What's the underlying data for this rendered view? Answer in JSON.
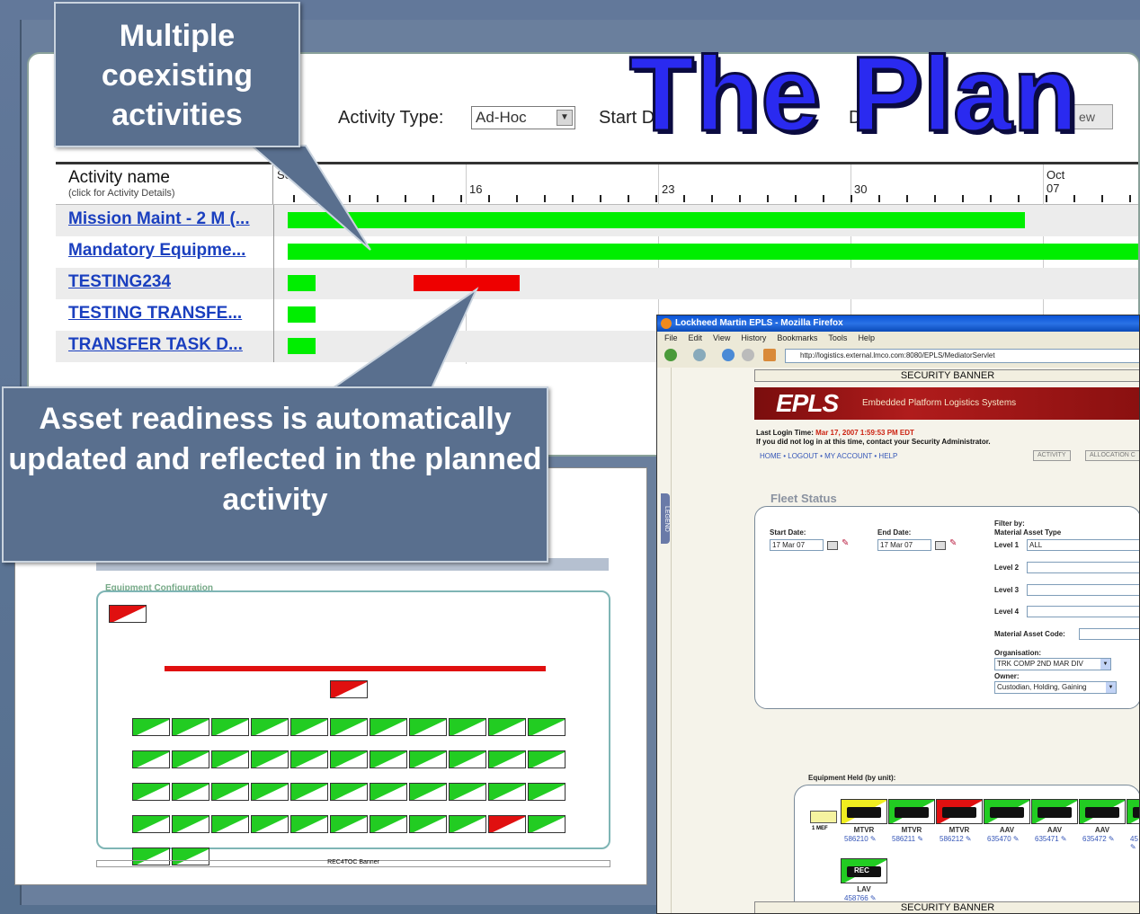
{
  "slide": {
    "title": "The Plan",
    "callout_top": "Multiple coexisting activities",
    "callout_bottom": "Asset readiness is automatically updated and reflected in the planned activity",
    "colors": {
      "background": "#5a7190",
      "callout": "#596f8e",
      "title": "#2a2af0"
    }
  },
  "gantt": {
    "toolbar": {
      "activity_type_label": "Activity Type:",
      "activity_type_value": "Ad-Hoc",
      "start_label": "Start D",
      "duration_label": "Du",
      "view_button": "ew"
    },
    "column_header": "Activity name",
    "column_subheader": "(click for Activity Details)",
    "dates": [
      {
        "label": "Sep"
      },
      {
        "label": "16"
      },
      {
        "label": "23"
      },
      {
        "label": "30"
      },
      {
        "label": "Oct\n07"
      }
    ],
    "rows": [
      {
        "name": "Mission Maint - 2 M (...",
        "bars": [
          {
            "start": 0,
            "end": 0.865,
            "color": "#00ee00"
          }
        ]
      },
      {
        "name": "Mandatory Equipme...",
        "bars": [
          {
            "start": 0,
            "end": 1,
            "color": "#00ee00"
          }
        ]
      },
      {
        "name": "TESTING234",
        "bars": [
          {
            "start": 0,
            "end": 0.033,
            "color": "#00ee00"
          },
          {
            "start": 0.148,
            "end": 0.272,
            "color": "#ee0000"
          }
        ]
      },
      {
        "name": "TESTING TRANSFE...",
        "bars": [
          {
            "start": 0,
            "end": 0.033,
            "color": "#00ee00"
          }
        ]
      },
      {
        "name": "TRANSFER TASK D...",
        "bars": [
          {
            "start": 0,
            "end": 0.033,
            "color": "#00ee00"
          }
        ]
      }
    ]
  },
  "equipment_config": {
    "title": "Equipment Configuration",
    "footer": "REC4TOC Banner"
  },
  "browser": {
    "window_title": "Lockheed Martin EPLS - Mozilla Firefox",
    "menu": [
      "File",
      "Edit",
      "View",
      "History",
      "Bookmarks",
      "Tools",
      "Help"
    ],
    "url": "http://logistics.external.lmco.com:8080/EPLS/MediatorServlet",
    "security_banner_top": "SECURITY BANNER",
    "security_banner_bottom": "SECURITY BANNER",
    "app_logo": "EPLS",
    "app_subtitle": "Embedded Platform Logistics Systems",
    "last_login_label": "Last Login Time:",
    "last_login_value": "Mar 17, 2007 1:59:53 PM EDT",
    "login_notice": "If you did not log in at this time, contact your Security Administrator.",
    "nav_links": "HOME • LOGOUT • MY ACCOUNT • HELP",
    "tabs": [
      "ACTIVITY",
      "ALLOCATION C"
    ],
    "legend_tab": "LEGEND",
    "page_title": "Fleet Status",
    "start_date_label": "Start Date:",
    "start_date_value": "17 Mar 07",
    "end_date_label": "End Date:",
    "end_date_value": "17 Mar 07",
    "filter_by_label": "Filter by:",
    "material_asset_type_label": "Material Asset Type",
    "level1_label": "Level 1",
    "level1_value": "ALL",
    "level2_label": "Level 2",
    "level3_label": "Level 3",
    "level4_label": "Level 4",
    "material_asset_code_label": "Material Asset Code:",
    "organisation_label": "Organisation:",
    "organisation_value": "TRK COMP 2ND MAR DIV",
    "owner_label": "Owner:",
    "owner_value": "Custodian, Holding, Gaining",
    "equipment_held_label": "Equipment Held (by unit):",
    "unit_label": "1 MEF",
    "vehicles": [
      {
        "type": "MTVR",
        "id": "586210",
        "status": "yellow"
      },
      {
        "type": "MTVR",
        "id": "586211",
        "status": "green"
      },
      {
        "type": "MTVR",
        "id": "586212",
        "status": "red"
      },
      {
        "type": "AAV",
        "id": "635470",
        "status": "green"
      },
      {
        "type": "AAV",
        "id": "635471",
        "status": "green"
      },
      {
        "type": "AAV",
        "id": "635472",
        "status": "green"
      },
      {
        "type": "",
        "id": "45",
        "status": "green"
      },
      {
        "type": "LAV",
        "id": "458766",
        "status": "rec",
        "badge": "REC"
      }
    ]
  }
}
